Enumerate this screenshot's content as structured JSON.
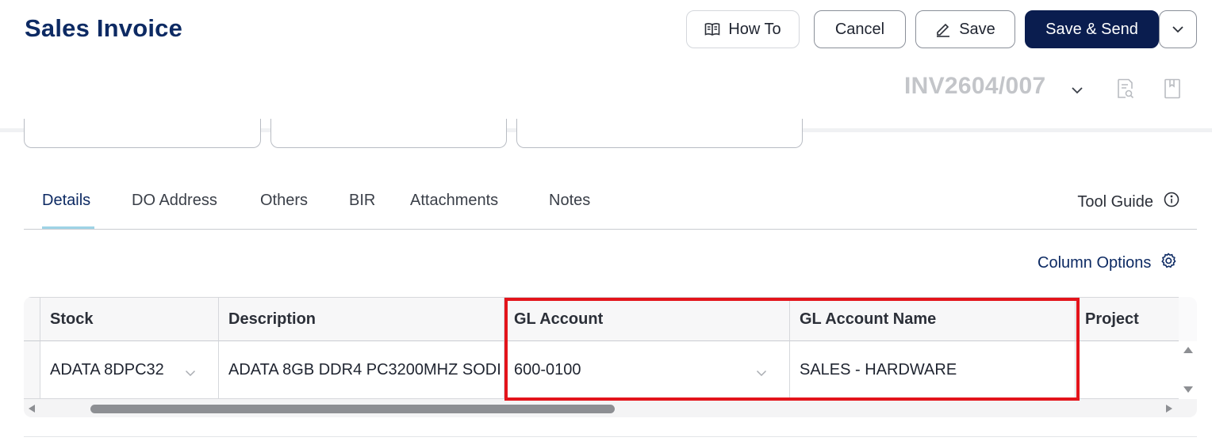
{
  "header": {
    "title": "Sales Invoice",
    "how_to_label": "How To",
    "cancel_label": "Cancel",
    "save_label": "Save",
    "save_send_label": "Save & Send",
    "document_number": "INV2604/007"
  },
  "tabs": [
    {
      "label": "Details",
      "active": true
    },
    {
      "label": "DO Address",
      "active": false
    },
    {
      "label": "Others",
      "active": false
    },
    {
      "label": "BIR",
      "active": false
    },
    {
      "label": "Attachments",
      "active": false
    },
    {
      "label": "Notes",
      "active": false
    }
  ],
  "tool_guide_label": "Tool Guide",
  "column_options_label": "Column Options",
  "grid": {
    "columns": [
      "Stock",
      "Description",
      "GL Account",
      "GL Account Name",
      "Project"
    ],
    "rows": [
      {
        "stock": "ADATA 8DPC32",
        "description": "ADATA 8GB DDR4 PC3200MHZ SODI",
        "gl_account": "600-0100",
        "gl_account_name": "SALES - HARDWARE",
        "project": ""
      }
    ]
  },
  "colors": {
    "brand": "#0d2a63",
    "primary_button": "#0a1d4f",
    "highlight": "#e3141b",
    "tab_underline": "#9ed3e6"
  },
  "icons": [
    "book-open-icon",
    "pencil-icon",
    "chevron-down-icon",
    "document-search-icon",
    "bookmark-icon",
    "info-icon",
    "gear-icon"
  ]
}
